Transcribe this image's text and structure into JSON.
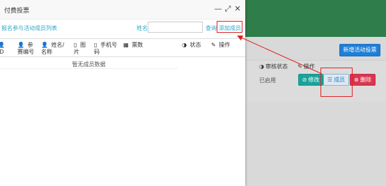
{
  "dialog": {
    "title": "付费投票",
    "minimize_glyph": "—",
    "maximize_glyph": "⤢",
    "close_glyph": "✕",
    "breadcrumb_link": "报名参与活动成员列表",
    "search": {
      "label": "姓名",
      "value": "",
      "placeholder": ""
    },
    "query_button": "查询",
    "add_member_button": "添加成员",
    "columns": [
      {
        "icon": "person-icon",
        "glyph": "👤",
        "label": "ID"
      },
      {
        "icon": "person-icon",
        "glyph": "👤",
        "label": "参赛编号"
      },
      {
        "icon": "person-icon",
        "glyph": "👤",
        "label": "姓名/名称"
      },
      {
        "icon": "mobile-icon",
        "glyph": "▯",
        "label": "图片"
      },
      {
        "icon": "mobile-icon",
        "glyph": "▯",
        "label": "手机号码"
      },
      {
        "icon": "calendar-icon",
        "glyph": "▦",
        "label": "票数"
      },
      {
        "icon": "half-circle-icon",
        "glyph": "◑",
        "label": "状态"
      },
      {
        "icon": "wrench-icon",
        "glyph": "✎",
        "label": "操作"
      }
    ],
    "empty_message": "暂无成员数据"
  },
  "background": {
    "add_activity_button": "新增活动投票",
    "columns": [
      {
        "icon": "half-circle-icon",
        "glyph": "◑",
        "label": "审核状态"
      },
      {
        "icon": "wrench-icon",
        "glyph": "✎",
        "label": "操作"
      }
    ],
    "row": {
      "status": "已启用",
      "edit_button": "修改",
      "member_button": "成员",
      "delete_button": "删除"
    }
  },
  "colors": {
    "header_green": "#2f7d4a",
    "accent_blue": "#1e7fd6",
    "teal": "#1aa39a",
    "red": "#d9364f",
    "link_cyan": "#2aa8c8",
    "highlight_red": "#e02020"
  }
}
